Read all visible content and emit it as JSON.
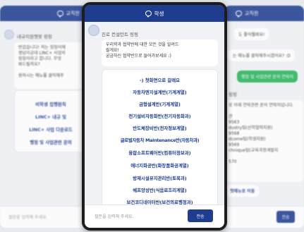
{
  "left": {
    "title": "교직원",
    "sender": "내규지원챗봇 링링",
    "greeting_lines": [
      "반갑습니다! 저는 링링이에",
      "영남이공대 LINC+ 사업의",
      "링링이라고 합니다. 무엇",
      "봐드릴까요?"
    ],
    "greeting_tail": "원하시는 메뉴를 클릭해주",
    "menu": [
      "비학생 집행원칙",
      "LINC+ 내규 및",
      "LINC+ 사업 다운로드",
      "행정 및 사업관련 문의"
    ],
    "input_placeholder": "질문을 입력해 주세요."
  },
  "center": {
    "title": "학생",
    "sender": "진로 컨설턴트 링링",
    "greeting_lines": [
      "우리학과 협약반에 대한 모든 것을 알려드",
      "릴게요!",
      "궁금하신 협약반으로 들어가보세요 :)"
    ],
    "menu": [
      "-) 첫화면으로 갈래요",
      "자동차엔지설계반(기계계열)",
      "금형설계반(기계계열)",
      "전기설비자동화반(전기자동화과)",
      "반도체장비반(전자정보계열)",
      "글로벌자동차 Maintenance반(자동차과)",
      "융합소프트웨어반(컴퓨터정보과)",
      "에너지화공반(화장품화공계열)",
      "방재시설유지관리반(토목과)",
      "쉐프양성반(식음료조리계열)",
      "보건코디네이터반(보건의료행정과)"
    ],
    "input_placeholder": "질문을 입력해 주세요.",
    "send_label": "전송"
  },
  "right": {
    "title": "교직원",
    "q1": "도 좋아뭘봐요!",
    "q2": "는 메뉴를 클릭해주시겠어요? :D",
    "green": "행정 및 사업관련 문의 연락처",
    "sender": "링링",
    "contact_lines": [
      "로 아래 연락관련 문의 연락처입니다.",
      "",
      "관",
      "9563",
      "dustry팀(산학협력지원)",
      "9568",
      "dcome팀(학생지원)",
      "9569",
      "chnique팀(교육과정개발지",
      "",
      "570"
    ],
    "home_label": "첫메뉴로 이동",
    "send_label": "전송"
  }
}
